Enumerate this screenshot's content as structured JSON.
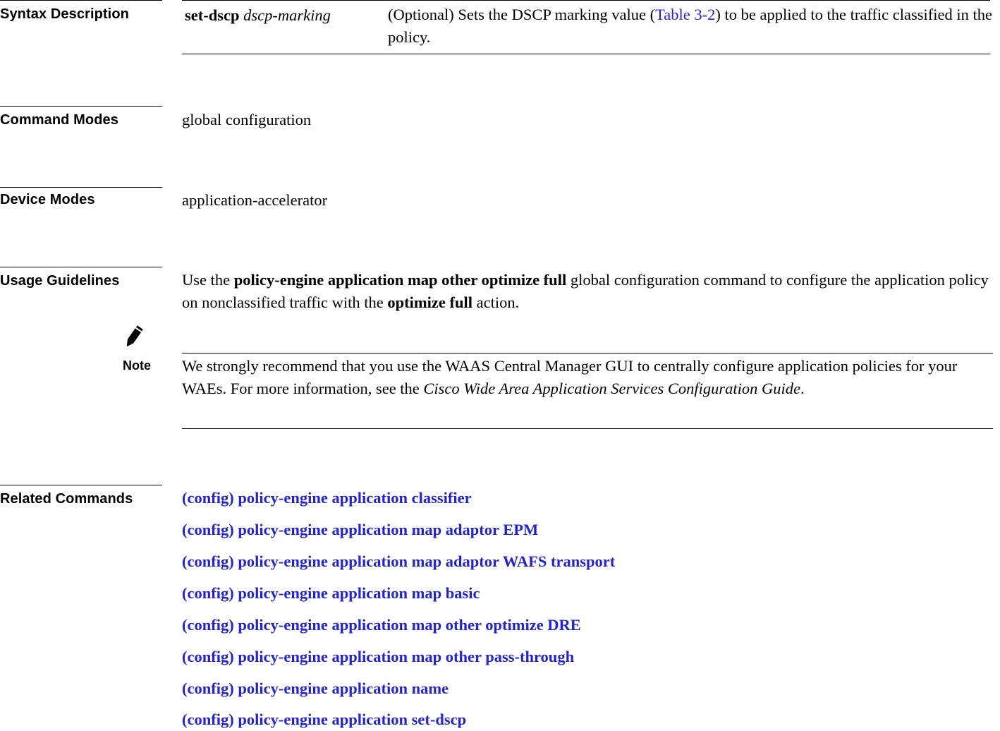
{
  "syntax": {
    "heading": "Syntax Description",
    "term_bold": "set-dscp",
    "term_italic": "dscp-marking",
    "desc_pre": "(Optional) Sets the DSCP marking value (",
    "desc_link": "Table 3-2",
    "desc_post": ") to be applied to the traffic classified in the policy."
  },
  "command_modes": {
    "heading": "Command Modes",
    "text": "global configuration"
  },
  "device_modes": {
    "heading": "Device Modes",
    "text": "application-accelerator"
  },
  "usage": {
    "heading": "Usage Guidelines",
    "p1": "Use the ",
    "p2": "policy-engine application map other optimize full",
    "p3": " global configuration command to configure the application policy on nonclassified traffic with the ",
    "p4": "optimize full",
    "p5": " action."
  },
  "note": {
    "label": "Note",
    "icon": "pencil-note-icon",
    "t1": "We strongly recommend that you use the WAAS Central Manager GUI to centrally configure application policies for your WAEs. For more information, see the ",
    "t2": "Cisco Wide Area Application Services Configuration Guide",
    "t3": "."
  },
  "related": {
    "heading": "Related Commands",
    "items": [
      "(config) policy-engine application classifier",
      "(config) policy-engine application map adaptor EPM",
      "(config) policy-engine application map adaptor WAFS transport",
      "(config) policy-engine application map basic",
      "(config) policy-engine application map other optimize DRE",
      "(config) policy-engine application map other pass-through",
      "(config) policy-engine application name",
      "(config) policy-engine application set-dscp"
    ]
  },
  "colors": {
    "link": "#2222dd",
    "text": "#000000"
  }
}
